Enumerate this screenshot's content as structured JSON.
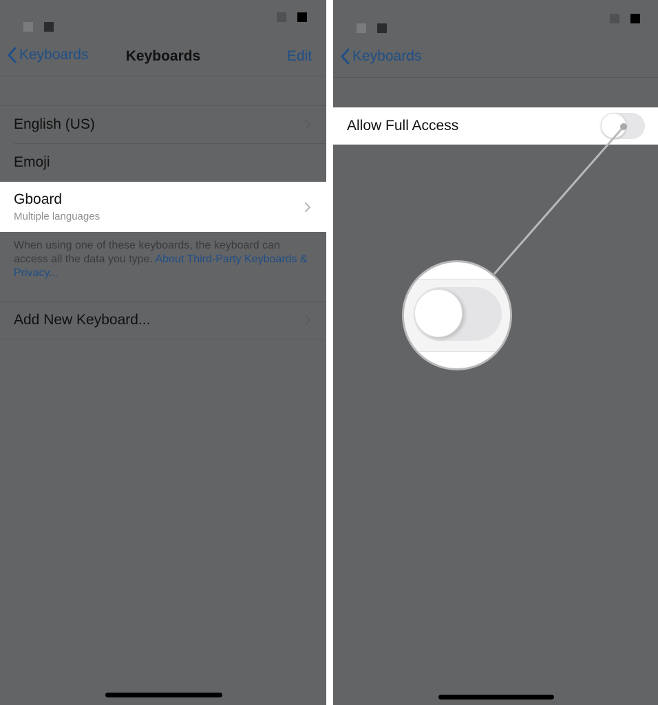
{
  "left_screen": {
    "nav": {
      "back_label": "Keyboards",
      "title": "Keyboards",
      "edit_label": "Edit"
    },
    "keyboards": [
      {
        "label": "English (US)",
        "has_chevron": true
      },
      {
        "label": "Emoji",
        "has_chevron": false
      },
      {
        "label": "Gboard",
        "sublabel": "Multiple languages",
        "has_chevron": true,
        "highlighted": true
      }
    ],
    "footer": {
      "text": "When using one of these keyboards, the keyboard can access all the data you type. ",
      "link": "About Third-Party Keyboards & Privacy..."
    },
    "add_keyboard_label": "Add New Keyboard..."
  },
  "right_screen": {
    "nav": {
      "back_label": "Keyboards"
    },
    "allow_full_access": {
      "label": "Allow Full Access",
      "enabled": false
    }
  },
  "colors": {
    "dimmed_background": "#636466",
    "link_blue": "#1f4f86",
    "highlight_row": "#ffffff",
    "toggle_off_track": "#e6e6e8"
  }
}
